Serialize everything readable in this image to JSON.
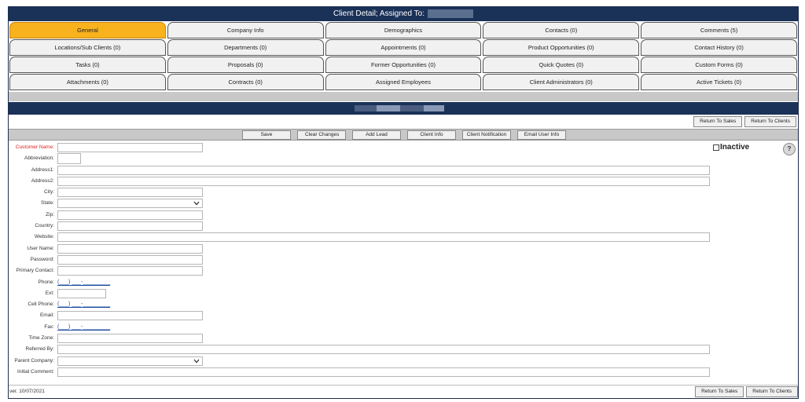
{
  "header": {
    "title": "Client Detail; Assigned To:"
  },
  "tabs": [
    [
      "General",
      "Company Info",
      "Demographics",
      "Contacts (0)",
      "Comments (5)"
    ],
    [
      "Locations/Sub Clients  (0)",
      "Departments (0)",
      "Appointments (0)",
      "Product Opportunities (0)",
      "Contact History (0)"
    ],
    [
      "Tasks (0)",
      "Proposals (0)",
      "Former Opportunities (0)",
      "Quick Quotes (0)",
      "Custom Forms (0)"
    ],
    [
      "Attachments (0)",
      "Contracts (0)",
      "Assigned Employees",
      "Client Administrators (0)",
      "Active Tickets (0)"
    ]
  ],
  "active_tab": "General",
  "top_buttons": {
    "return_to_sales": "Return To Sales",
    "return_to_clients": "Return To Clients"
  },
  "toolbar": {
    "save": "Save",
    "clear_changes": "Clear Changes",
    "add_lead": "Add Lead",
    "client_info": "Client Info",
    "client_notification": "Client Notification",
    "email_user_info": "Email User Info"
  },
  "form": {
    "customer_name": "Customer Name:",
    "abbreviation": "Abbreviation:",
    "address1": "Address1:",
    "address2": "Address2:",
    "city": "City:",
    "state": "State:",
    "zip": "Zip:",
    "country": "Country:",
    "website": "Website:",
    "user_name": "User Name:",
    "password": "Password:",
    "primary_contact": "Primary Contact:",
    "phone": "Phone:",
    "ext": "Ext:",
    "cell_phone": "Cell Phone:",
    "email": "Email:",
    "fax": "Fax:",
    "time_zone": "Time Zone:",
    "referred_by": "Referred By:",
    "parent_company": "Parent Company:",
    "initial_comment": "Initial Comment:",
    "phone_mask": "(___) ___-_________",
    "cell_phone_mask": "(___) ___-_________",
    "fax_mask": "(___) ___-_________"
  },
  "inactive_label": "Inactive",
  "help_label": "?",
  "footer": {
    "version": "ver. 10/07/2021",
    "return_to_sales": "Return To Sales",
    "return_to_clients": "Return To Clients"
  },
  "colors": {
    "header_navy": "#1a3158",
    "active_tab": "#f7b21d",
    "required_label": "#e02020",
    "phone_mask": "#1a4aa0"
  }
}
